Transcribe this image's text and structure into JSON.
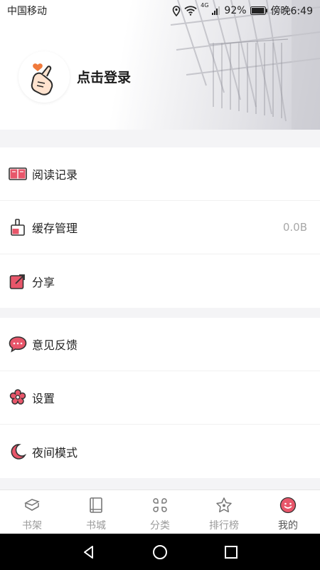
{
  "status_bar": {
    "carrier": "中国移动",
    "battery": "92%",
    "time": "傍晚6:49",
    "network": "4G"
  },
  "header": {
    "login_label": "点击登录"
  },
  "menu_group_1": [
    {
      "label": "阅读记录",
      "icon": "book-icon"
    },
    {
      "label": "缓存管理",
      "icon": "broom-icon",
      "value": "0.0B"
    },
    {
      "label": "分享",
      "icon": "share-icon"
    }
  ],
  "menu_group_2": [
    {
      "label": "意见反馈",
      "icon": "chat-bubble-icon"
    },
    {
      "label": "设置",
      "icon": "gear-flower-icon"
    },
    {
      "label": "夜间模式",
      "icon": "moon-icon"
    }
  ],
  "tabbar": [
    {
      "label": "书架",
      "icon": "bookshelf-icon",
      "active": false
    },
    {
      "label": "书城",
      "icon": "book-store-icon",
      "active": false
    },
    {
      "label": "分类",
      "icon": "category-icon",
      "active": false
    },
    {
      "label": "排行榜",
      "icon": "star-icon",
      "active": false
    },
    {
      "label": "我的",
      "icon": "smiley-icon",
      "active": true
    }
  ],
  "colors": {
    "accent": "#e8566a",
    "icon_dark": "#444444",
    "tab_inactive": "#9a9a9a"
  }
}
